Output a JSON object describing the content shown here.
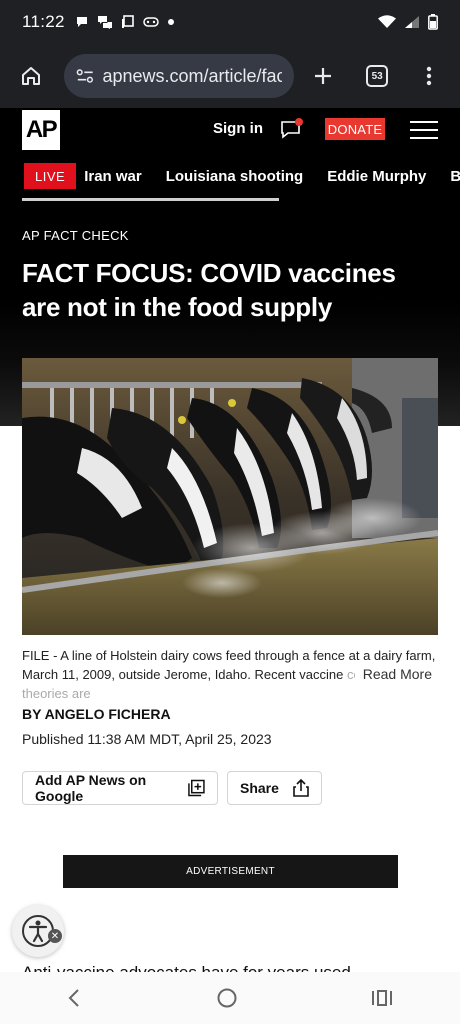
{
  "status_bar": {
    "time": "11:22",
    "left_icons": [
      "chat-bubble-icon",
      "chat-bubbles-icon",
      "copy-icon",
      "gamepad-icon",
      "dot-icon"
    ],
    "right_icons": [
      "wifi-icon",
      "signal-icon",
      "battery-icon"
    ]
  },
  "browser": {
    "url": "apnews.com/article/fact-",
    "tab_count": "53",
    "icons": [
      "home-icon",
      "site-settings-icon",
      "new-tab-plus-icon",
      "tab-switcher-icon",
      "more-vert-icon"
    ]
  },
  "site_header": {
    "logo_text": "AP",
    "sign_in": "Sign in",
    "donate": "DONATE",
    "accent_red": "#e8382f"
  },
  "nav": {
    "live": "LIVE",
    "items": [
      "Iran war",
      "Louisiana shooting",
      "Eddie Murphy",
      "Baby"
    ]
  },
  "article": {
    "kicker": "AP FACT CHECK",
    "headline": "FACT FOCUS: COVID vaccines are not in the food supply",
    "caption_main": "FILE - A line of Holstein dairy cows feed through a fence at a dairy farm, March 11, 2009, outside Jerome, Idaho. Recent vaccine ",
    "caption_fade": "conspiracy theories are",
    "read_more": "Read More",
    "byline": "BY  ANGELO FICHERA",
    "published": "Published 11:38 AM MDT, April 25, 2023",
    "teaser": "Anti-vaccine advocates have for years used"
  },
  "actions": {
    "google": "Add AP News on Google",
    "share": "Share"
  },
  "ad": {
    "label": "ADVERTISEMENT"
  },
  "system_nav": [
    "back-icon",
    "home-circle-icon",
    "recents-icon"
  ]
}
